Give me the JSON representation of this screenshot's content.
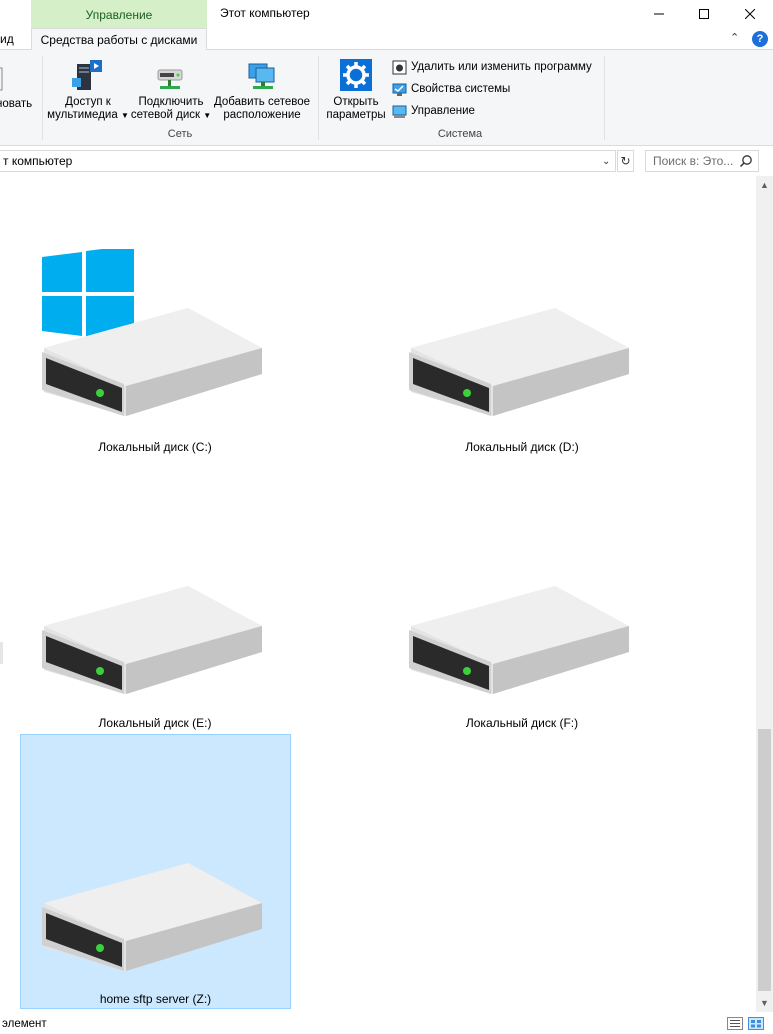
{
  "window": {
    "context_tab": "Управление",
    "title": "Этот компьютер"
  },
  "ribbon": {
    "tabs": {
      "view_partial": "Вид",
      "drive_tools": "Средства работы с дисками"
    },
    "buttons": {
      "rename_partial": "новать",
      "media_access_line1": "Доступ к",
      "media_access_line2": "мультимедиа",
      "map_drive_line1": "Подключить",
      "map_drive_line2": "сетевой диск",
      "add_network_line1": "Добавить сетевое",
      "add_network_line2": "расположение",
      "open_settings_line1": "Открыть",
      "open_settings_line2": "параметры"
    },
    "system_items": [
      "Удалить или изменить программу",
      "Свойства системы",
      "Управление"
    ],
    "groups": {
      "network": "Сеть",
      "system": "Система"
    }
  },
  "address": {
    "path_partial": "т компьютер",
    "search_placeholder": "Поиск в: Это..."
  },
  "drives": [
    {
      "label": "Локальный диск (C:)",
      "system": true,
      "selected": false
    },
    {
      "label": "Локальный диск (D:)",
      "system": false,
      "selected": false
    },
    {
      "label": "Локальный диск (E:)",
      "system": false,
      "selected": false
    },
    {
      "label": "Локальный диск (F:)",
      "system": false,
      "selected": false
    },
    {
      "label": "home sftp server (Z:)",
      "system": false,
      "selected": true
    }
  ],
  "status": {
    "text_partial": "элемент"
  },
  "colors": {
    "manage_tab_bg": "#d5f0c8",
    "selection_bg": "#cce8ff",
    "selection_border": "#99d1ff",
    "windows_logo": "#00adef",
    "drive_led": "#3bd13b"
  },
  "icons": {
    "minimize": "minimize-icon",
    "maximize": "maximize-icon",
    "close": "close-icon",
    "help": "help-icon",
    "search": "search-icon",
    "refresh": "refresh-icon"
  }
}
